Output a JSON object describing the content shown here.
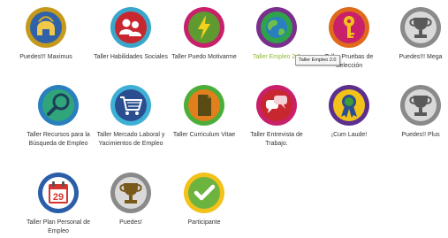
{
  "badges": [
    {
      "name": "Puedes!!! Maximus",
      "icon": "spartan-helmet-icon",
      "ring": "#c59a1c",
      "fill": "#2f62a8"
    },
    {
      "name": "Taller Habilidades Sociales",
      "icon": "people-icon",
      "ring": "#3aa6c9",
      "fill": "#c8272f"
    },
    {
      "name": "Taller Puedo Motivarme",
      "icon": "lightning-icon",
      "ring": "#c8206a",
      "fill": "#5e9a2f"
    },
    {
      "name": "Taller Empleo 2.0",
      "icon": "globe-icon",
      "ring": "#7a2f8c",
      "fill": "#2ea34a"
    },
    {
      "name": "Taller Pruebas de Selección",
      "icon": "key-icon",
      "ring": "#e06a1b",
      "fill": "#c8206a"
    },
    {
      "name": "Puedes!!! Mega",
      "icon": "trophy-icon",
      "ring": "#8a8a8a",
      "fill": "#d9d9d9"
    },
    {
      "name": "Taller Recursos para la Búsqueda de Empleo",
      "icon": "magnifier-icon",
      "ring": "#2a7fbf",
      "fill": "#30a57a"
    },
    {
      "name": "Taller Mercado Laboral y Yacimientos de Empleo",
      "icon": "shopping-cart-icon",
      "ring": "#3eb0d6",
      "fill": "#2a4e8f"
    },
    {
      "name": "Taller Curriculum Vitae",
      "icon": "document-icon",
      "ring": "#4cae3a",
      "fill": "#e07f1b"
    },
    {
      "name": "Taller Entrevista de Trabajo.",
      "icon": "speech-bubbles-icon",
      "ring": "#c8206a",
      "fill": "#c8272f"
    },
    {
      "name": "¡Cum Laude!",
      "icon": "ribbon-award-icon",
      "ring": "#5c2f8e",
      "fill": "#f2c21a"
    },
    {
      "name": "Puedes!! Plus",
      "icon": "trophy-icon",
      "ring": "#8a8a8a",
      "fill": "#d9d9d9"
    },
    {
      "name": "Taller Plan Personal de Empleo",
      "icon": "calendar-icon",
      "ring": "#2a5ea8",
      "fill": "#ffffff"
    },
    {
      "name": "Puedes!",
      "icon": "trophy-icon",
      "ring": "#8a8a8a",
      "fill": "#d9d9d9"
    },
    {
      "name": "Participante",
      "icon": "checkmark-icon",
      "ring": "#f2c21a",
      "fill": "#6db33f"
    }
  ],
  "calendar_day": "29",
  "tooltip_text": "Taller Empleo 2.0",
  "highlight_color": "#8cb832"
}
